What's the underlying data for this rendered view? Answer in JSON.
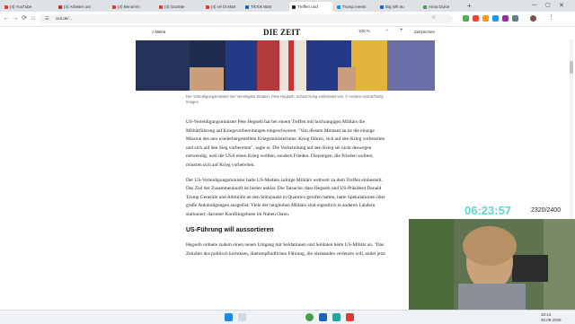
{
  "browser": {
    "tabs": [
      {
        "label": "(4) YouTube",
        "color": "#e53935"
      },
      {
        "label": "(4) Arbeiter unt",
        "color": "#c62828"
      },
      {
        "label": "(4) Benomm",
        "color": "#e53935"
      },
      {
        "label": "(4) Gazette",
        "color": "#e53935"
      },
      {
        "label": "(4) Ve bt Mart",
        "color": "#e53935"
      },
      {
        "label": "TikTok Wart",
        "color": "#1565c0"
      },
      {
        "label": "Treffen und",
        "color": "#222222"
      },
      {
        "label": "Trump meets",
        "color": "#1e88e5"
      },
      {
        "label": "Big Wh 4u",
        "color": "#1565c0"
      },
      {
        "label": "Anna Dulce",
        "color": "#43a047"
      }
    ],
    "url": "zeit.de/...",
    "new_tab": "+"
  },
  "site": {
    "menu_label": "Menü",
    "logo": "DIE ZEIT",
    "zoom": "100 %",
    "zoom_minus": "−",
    "zoom_plus": "+",
    "abo_label": "Zeitzeichen"
  },
  "article": {
    "caption": "Der Verteidigungsminister der Vereinigten Staaten, Pete Hegseth, schaut Krieg vorbereitet war. © Andrew Harnik/Getty Images",
    "p1": "US-Verteidigungsminister Pete Hegseth hat bei einem Treffen mit hochrangigen Militärs die Militärführung auf Kriegsvorbereitungen eingeschworen. \"Von diesem Moment an ist die einzige Mission des neu wiederhergestellten Kriegsministeriums: Krieg führen, sich auf den Krieg vorbereiten und sich auf den Sieg vorbereiten\", sagte er. Die Vorbereitung auf den Krieg sei nicht deswegen notwendig, weil die USA einen Krieg wollten, sondern Frieden. Diejenigen, die Frieden wollten, müssten sich auf Krieg vorbereiten.",
    "p2": "Der US-Verteidigungsminister hatte US-Medien zufolge Militärs weltweit zu dem Treffen einbestellt. Das Ziel der Zusammenkunft ist bisher unklar. Die Tatsache, dass Hegseth und US-Präsident Donald Trump Generäle und Admiräle an den Stützpunkt in Quantico gerufen hatten, hatte Spekulationen über große Ankündigungen ausgelöst. Viele der ranghohen Militärs sind eigentlich in anderen Ländern stationiert, darunter Konfliktgebiete im Nahen Osten.",
    "heading": "US-Führung will aussortieren",
    "p3": "Hegseth ordnete zudem einen neuen Umgang mit Soldatinnen und Soldaten beim US-Militär an. \"Das Zeitalter des politisch korrekten, überempfindlichen Führung, die niemanden verletzen will, endet jetzt"
  },
  "overlay": {
    "timer": "06:23:57",
    "counter": "2320/2400",
    "timer_color": "#5fd7c6"
  },
  "taskbar": {
    "time": "10:14",
    "date": "30.09.2025"
  },
  "colors": {
    "hero": "#3b4d8a",
    "accent": "#5fd7c6"
  }
}
